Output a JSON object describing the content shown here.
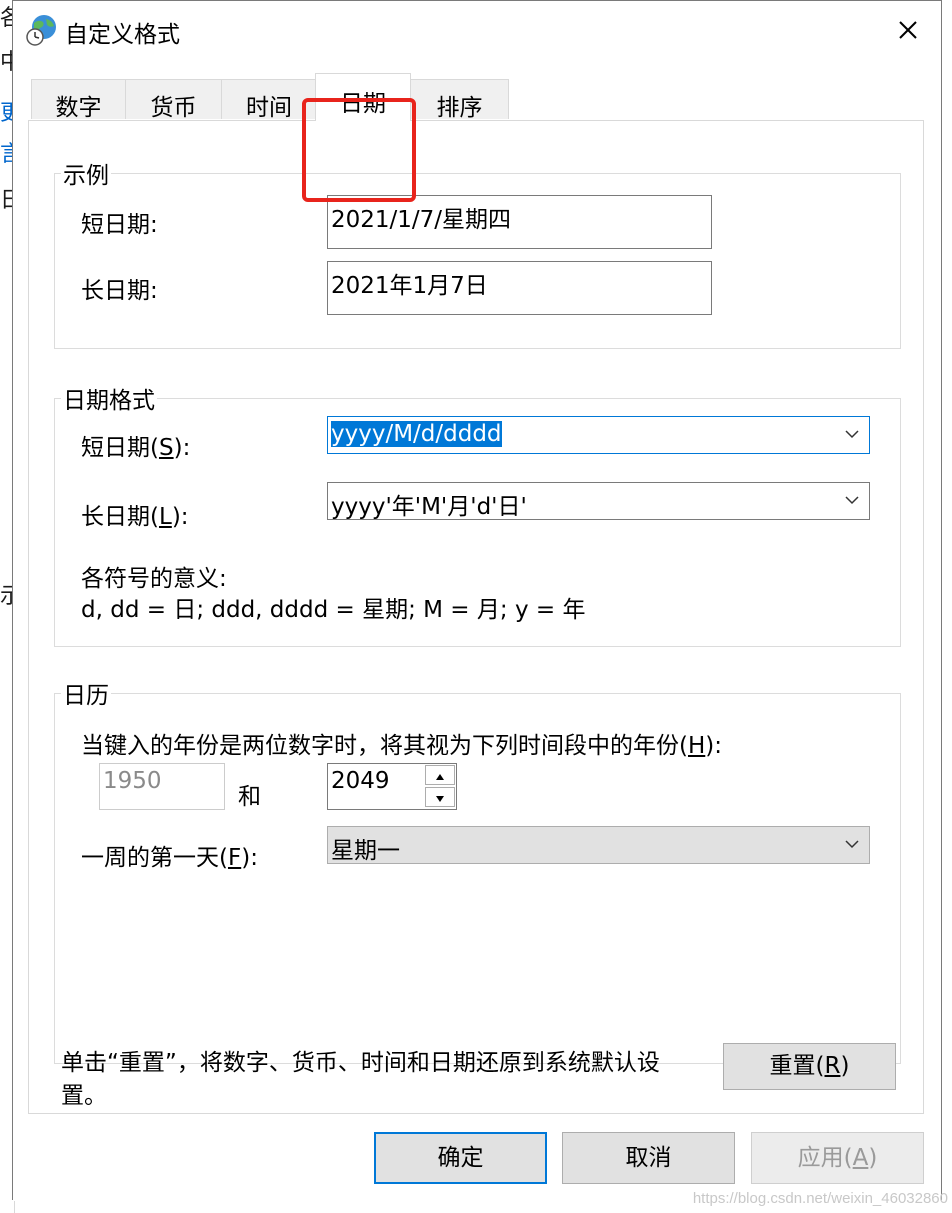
{
  "background": {
    "chars": [
      "各",
      "中",
      "更",
      "言",
      "日",
      "示"
    ]
  },
  "window": {
    "title": "自定义格式",
    "icon": "globe-clock-icon",
    "close_icon": "close-icon"
  },
  "tabs": [
    {
      "label": "数字",
      "active": false
    },
    {
      "label": "货币",
      "active": false
    },
    {
      "label": "时间",
      "active": false
    },
    {
      "label": "日期",
      "active": true
    },
    {
      "label": "排序",
      "active": false
    }
  ],
  "example": {
    "legend": "示例",
    "short_label": "短日期:",
    "short_value": "2021/1/7/星期四",
    "long_label": "长日期:",
    "long_value": "2021年1月7日"
  },
  "date_format": {
    "legend": "日期格式",
    "short_label_main": "短日期(",
    "short_label_key": "S",
    "short_label_end": "):",
    "short_value": "yyyy/M/d/dddd",
    "long_label_main": "长日期(",
    "long_label_key": "L",
    "long_label_end": "):",
    "long_value": "yyyy'年'M'月'd'日'",
    "meaning_title": "各符号的意义:",
    "meaning_text": "d, dd = 日;  ddd, dddd = 星期;  M = 月;  y = 年"
  },
  "calendar": {
    "legend": "日历",
    "twodigit_label_main": "当键入的年份是两位数字时，将其视为下列时间段中的年份(",
    "twodigit_label_key": "H",
    "twodigit_label_end": "):",
    "from_year": "1950",
    "and_label": "和",
    "to_year": "2049",
    "first_day_label_main": "一周的第一天(",
    "first_day_label_key": "F",
    "first_day_label_end": "):",
    "first_day_value": "星期一"
  },
  "reset": {
    "text_line1": "单击“重置”，将数字、货币、时间和日期还原到系统默认设",
    "text_line2": "置。",
    "button_main": "重置(",
    "button_key": "R",
    "button_end": ")"
  },
  "footer": {
    "ok": "确定",
    "cancel": "取消",
    "apply_main": "应用(",
    "apply_key": "A",
    "apply_end": ")"
  },
  "watermark": "https://blog.csdn.net/weixin_46032860",
  "colors": {
    "highlight": "#e8241c",
    "accent": "#0078d7"
  }
}
